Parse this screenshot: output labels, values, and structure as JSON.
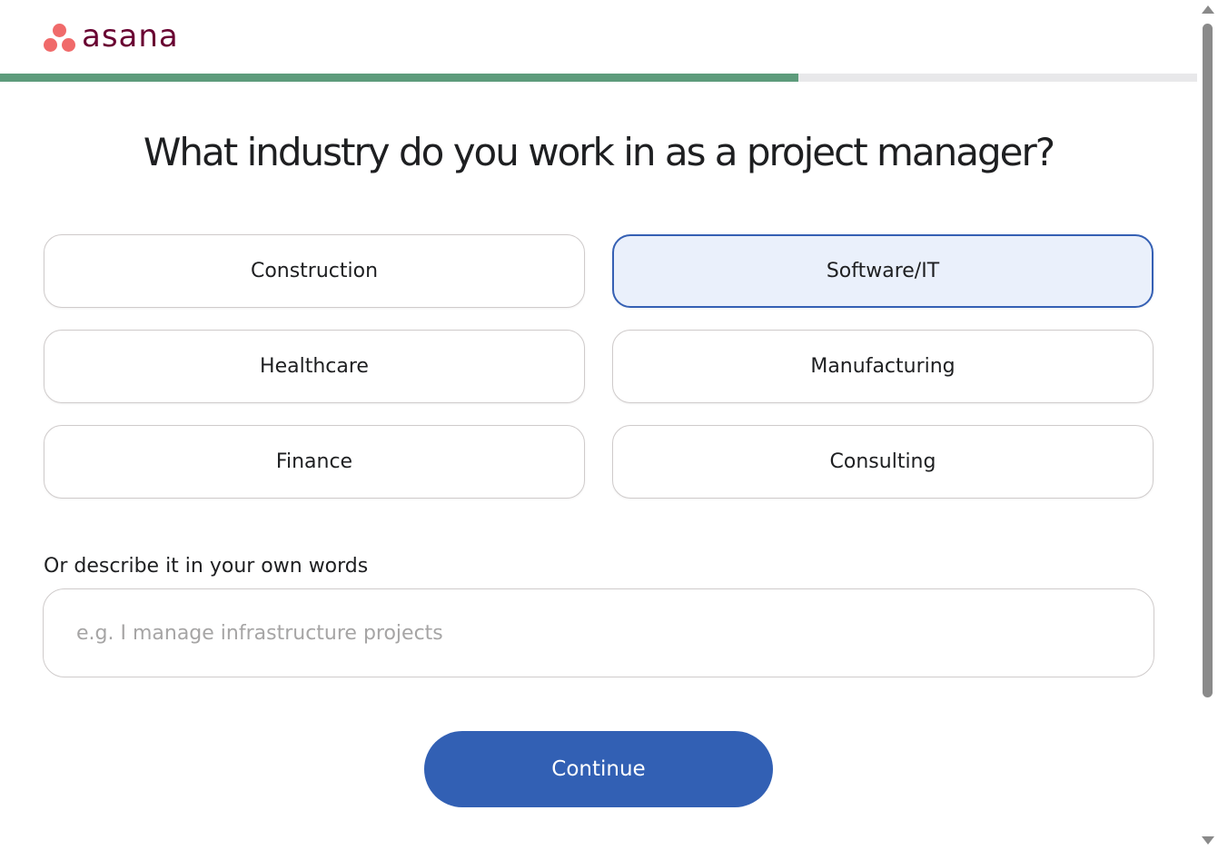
{
  "header": {
    "logo_text": "asana"
  },
  "progress": {
    "fraction": 0.667
  },
  "main": {
    "title": "What industry do you work in as a project manager?",
    "options": [
      {
        "label": "Construction",
        "selected": false
      },
      {
        "label": "Software/IT",
        "selected": true
      },
      {
        "label": "Healthcare",
        "selected": false
      },
      {
        "label": "Manufacturing",
        "selected": false
      },
      {
        "label": "Finance",
        "selected": false
      },
      {
        "label": "Consulting",
        "selected": false
      }
    ],
    "describe_label": "Or describe it in your own words",
    "describe_value": "",
    "describe_placeholder": "e.g. I manage infrastructure projects",
    "continue_label": "Continue"
  },
  "colors": {
    "brand_dots": "#f06a6a",
    "brand_text": "#690031",
    "progress_fill": "#5d9b7b",
    "selected_border": "#3560b4",
    "selected_bg": "#eaf0fb",
    "primary_button": "#3260b4"
  }
}
